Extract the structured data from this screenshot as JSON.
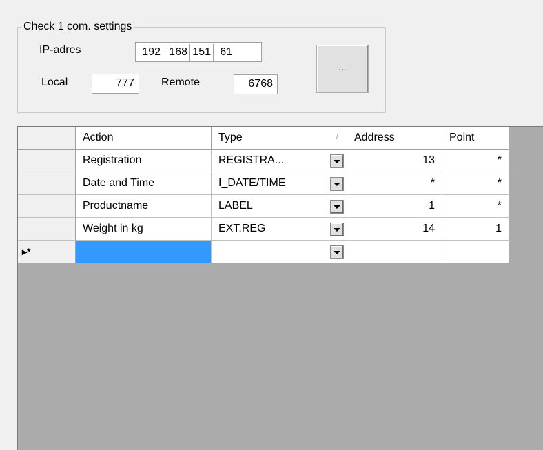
{
  "group": {
    "title": "Check 1  com. settings",
    "ip_label": "IP-adres",
    "ip": [
      "192",
      "168",
      "151",
      "61"
    ],
    "local_label": "Local",
    "local_value": "777",
    "remote_label": "Remote",
    "remote_value": "6768",
    "browse_label": "..."
  },
  "grid": {
    "columns": [
      "Action",
      "Type",
      "Address",
      "Point"
    ],
    "sort_glyph": "/",
    "rows": [
      {
        "action": "Registration",
        "type": "REGISTRA...",
        "address": "13",
        "point": "*"
      },
      {
        "action": "Date and Time",
        "type": "I_DATE/TIME",
        "address": "*",
        "point": "*"
      },
      {
        "action": "Productname",
        "type": "LABEL",
        "address": "1",
        "point": "*"
      },
      {
        "action": "Weight in kg",
        "type": "EXT.REG",
        "address": "14",
        "point": "1"
      }
    ],
    "new_row_marker": "▸*",
    "new_row": {
      "action": "",
      "type": "",
      "address": "",
      "point": ""
    },
    "colors": {
      "selected": "#3399ff",
      "background": "#ababab"
    }
  }
}
